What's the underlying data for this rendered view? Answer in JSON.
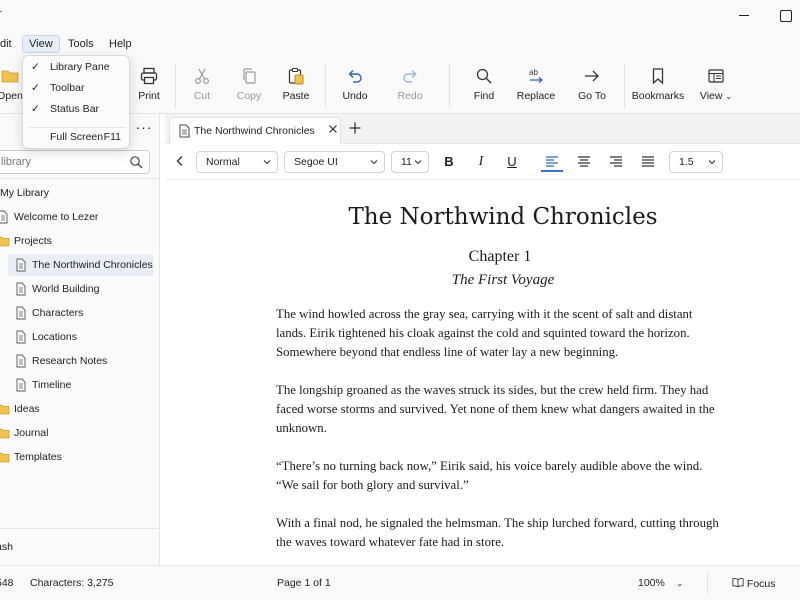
{
  "app": {
    "title_fragment": "r"
  },
  "menubar": {
    "items": [
      "dit",
      "View",
      "Tools",
      "Help"
    ]
  },
  "toolbar": {
    "open": "Open",
    "print": "Print",
    "cut": "Cut",
    "copy": "Copy",
    "paste": "Paste",
    "undo": "Undo",
    "redo": "Redo",
    "find": "Find",
    "replace": "Replace",
    "goto": "Go To",
    "bookmarks": "Bookmarks",
    "view": "View"
  },
  "view_menu": {
    "items": [
      {
        "label": "Library Pane",
        "checked": true
      },
      {
        "label": "Toolbar",
        "checked": true
      },
      {
        "label": "Status Bar",
        "checked": true
      },
      {
        "label": "Full Screen",
        "shortcut": "F11",
        "checked": false
      }
    ]
  },
  "sidebar": {
    "more": "···",
    "search_placeholder": "library",
    "tree": [
      {
        "label": "My Library",
        "icon": "library-icon",
        "level": 0
      },
      {
        "label": "Welcome to Lezer",
        "icon": "document-icon",
        "level": 0
      },
      {
        "label": "Projects",
        "icon": "folder-icon",
        "level": 0
      },
      {
        "label": "The Northwind Chronicles",
        "icon": "document-icon",
        "level": 1,
        "selected": true
      },
      {
        "label": "World Building",
        "icon": "document-icon",
        "level": 1
      },
      {
        "label": "Characters",
        "icon": "document-icon",
        "level": 1
      },
      {
        "label": "Locations",
        "icon": "document-icon",
        "level": 1
      },
      {
        "label": "Research Notes",
        "icon": "document-icon",
        "level": 1
      },
      {
        "label": "Timeline",
        "icon": "document-icon",
        "level": 1
      },
      {
        "label": "Ideas",
        "icon": "folder-icon",
        "level": 0
      },
      {
        "label": "Journal",
        "icon": "folder-icon",
        "level": 0
      },
      {
        "label": "Templates",
        "icon": "folder-icon",
        "level": 0
      }
    ],
    "trash": "ash"
  },
  "tabs": [
    {
      "label": "The Northwind Chronicles"
    }
  ],
  "format": {
    "style": "Normal",
    "font": "Segoe UI",
    "size": "11",
    "bold": "B",
    "italic": "I",
    "underline": "U",
    "line_spacing": "1.5"
  },
  "document": {
    "title": "The Northwind Chronicles",
    "chapter": "Chapter 1",
    "subtitle": "The First Voyage",
    "paragraphs": [
      "The wind howled across the gray sea, carrying with it the scent of salt and distant lands. Eirik tightened his cloak against the cold and squinted toward the horizon. Somewhere beyond that endless line of water lay a new beginning.",
      "The longship groaned as the waves struck its sides, but the crew held firm. They had faced worse storms and survived. Yet none of them knew what dangers awaited in the unknown.",
      "“There’s no turning back now,” Eirik said, his voice barely audible above the wind. “We sail for both glory and survival.”",
      "With a final nod, he signaled the helmsman. The ship lurched forward, cutting through the waves toward whatever fate had in store."
    ]
  },
  "status": {
    "words": "548",
    "characters": "Characters: 3,275",
    "page": "Page 1 of 1",
    "zoom": "100%",
    "focus": "Focus"
  },
  "colors": {
    "accent": "#3a6fc2",
    "folder": "#f2c14e",
    "selection": "#e9eef6"
  }
}
